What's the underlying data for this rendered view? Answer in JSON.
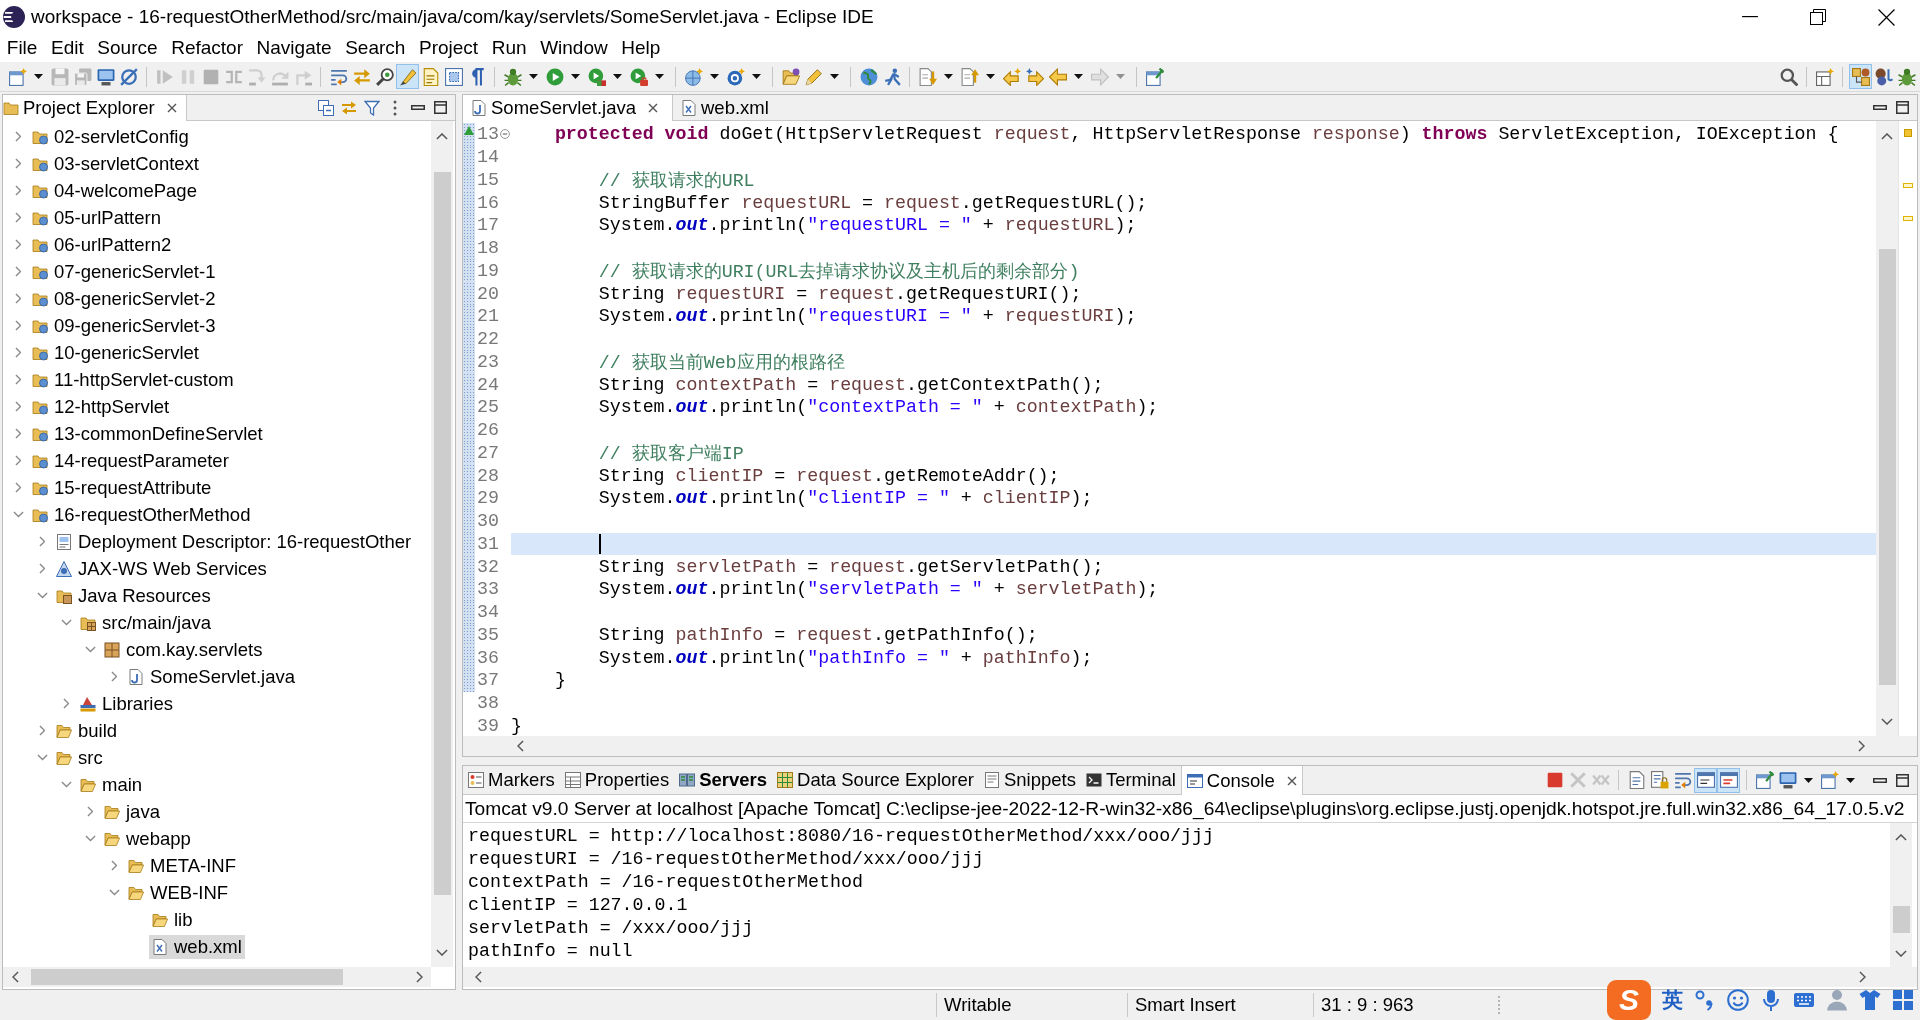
{
  "window": {
    "title": "workspace - 16-requestOtherMethod/src/main/java/com/kay/servlets/SomeServlet.java - Eclipse IDE"
  },
  "menu": [
    {
      "label": "File"
    },
    {
      "label": "Edit"
    },
    {
      "label": "Source"
    },
    {
      "label": "Refactor"
    },
    {
      "label": "Navigate"
    },
    {
      "label": "Search"
    },
    {
      "label": "Project"
    },
    {
      "label": "Run"
    },
    {
      "label": "Window"
    },
    {
      "label": "Help"
    }
  ],
  "toolbar": {
    "main": [
      [
        {
          "kind": "new_wizard",
          "disabled": false,
          "pressed": false,
          "dropdown": true
        },
        {
          "kind": "save",
          "disabled": true,
          "pressed": false,
          "dropdown": false
        },
        {
          "kind": "save_all",
          "disabled": true,
          "pressed": false,
          "dropdown": false
        },
        {
          "kind": "terminal",
          "disabled": false,
          "pressed": false,
          "dropdown": false
        },
        {
          "kind": "skip_breakpoints",
          "disabled": false,
          "pressed": false,
          "dropdown": false
        }
      ],
      [
        {
          "kind": "resume",
          "disabled": true,
          "pressed": false,
          "dropdown": false
        },
        {
          "kind": "suspend",
          "disabled": true,
          "pressed": false,
          "dropdown": false
        },
        {
          "kind": "terminate",
          "disabled": true,
          "pressed": false,
          "dropdown": false
        },
        {
          "kind": "disconnect",
          "disabled": true,
          "pressed": false,
          "dropdown": false
        },
        {
          "kind": "step_into",
          "disabled": true,
          "pressed": false,
          "dropdown": false
        },
        {
          "kind": "step_over",
          "disabled": true,
          "pressed": false,
          "dropdown": false
        },
        {
          "kind": "step_return",
          "disabled": true,
          "pressed": false,
          "dropdown": false
        }
      ],
      [
        {
          "kind": "word_wrap",
          "disabled": false,
          "pressed": false,
          "dropdown": false
        },
        {
          "kind": "swap",
          "disabled": false,
          "pressed": false,
          "dropdown": false
        },
        {
          "kind": "inspect",
          "disabled": false,
          "pressed": false,
          "dropdown": false
        },
        {
          "kind": "mark_occurrences",
          "disabled": false,
          "pressed": true,
          "dropdown": false
        },
        {
          "kind": "annotation",
          "disabled": false,
          "pressed": false,
          "dropdown": false
        },
        {
          "kind": "block_selection",
          "disabled": false,
          "pressed": false,
          "dropdown": false
        },
        {
          "kind": "whitespace",
          "disabled": false,
          "pressed": false,
          "dropdown": false
        }
      ],
      [
        {
          "kind": "debug",
          "disabled": false,
          "pressed": false,
          "dropdown": true
        },
        {
          "kind": "run",
          "disabled": false,
          "pressed": false,
          "dropdown": true
        },
        {
          "kind": "coverage",
          "disabled": false,
          "pressed": false,
          "dropdown": true
        },
        {
          "kind": "external_tools",
          "disabled": false,
          "pressed": false,
          "dropdown": true
        }
      ],
      [
        {
          "kind": "new_server",
          "disabled": false,
          "pressed": false,
          "dropdown": true
        },
        {
          "kind": "new_class",
          "disabled": false,
          "pressed": false,
          "dropdown": true
        }
      ],
      [
        {
          "kind": "open_type",
          "disabled": false,
          "pressed": false,
          "dropdown": false
        },
        {
          "kind": "search_pencil",
          "disabled": false,
          "pressed": false,
          "dropdown": true
        }
      ],
      [
        {
          "kind": "browser",
          "disabled": false,
          "pressed": false,
          "dropdown": false
        },
        {
          "kind": "runner",
          "disabled": false,
          "pressed": false,
          "dropdown": false
        }
      ],
      [
        {
          "kind": "next_annotation",
          "disabled": false,
          "pressed": false,
          "dropdown": true
        },
        {
          "kind": "prev_annotation",
          "disabled": false,
          "pressed": false,
          "dropdown": true
        },
        {
          "kind": "last_edit_back",
          "disabled": false,
          "pressed": false,
          "dropdown": false
        },
        {
          "kind": "last_edit_forward",
          "disabled": false,
          "pressed": false,
          "dropdown": false
        },
        {
          "kind": "back",
          "disabled": false,
          "pressed": false,
          "dropdown": true
        },
        {
          "kind": "forward",
          "disabled": true,
          "pressed": false,
          "dropdown": true
        }
      ],
      [
        {
          "kind": "pin_editor",
          "disabled": false,
          "pressed": false,
          "dropdown": false
        }
      ]
    ],
    "right": [
      [
        {
          "kind": "search",
          "disabled": false,
          "pressed": false,
          "dropdown": false
        }
      ],
      [
        {
          "kind": "open_perspective",
          "disabled": false,
          "pressed": false,
          "dropdown": false
        }
      ],
      [
        {
          "kind": "perspective_javaee",
          "disabled": false,
          "pressed": true,
          "dropdown": false
        },
        {
          "kind": "perspective_java",
          "disabled": false,
          "pressed": false,
          "dropdown": false
        },
        {
          "kind": "perspective_debug",
          "disabled": false,
          "pressed": false,
          "dropdown": false
        }
      ]
    ]
  },
  "project_explorer": {
    "title": "Project Explorer",
    "tree": [
      {
        "label": "02-servletConfig",
        "kind": "project",
        "expanded": false,
        "selected": false
      },
      {
        "label": "03-servletContext",
        "kind": "project",
        "expanded": false,
        "selected": false
      },
      {
        "label": "04-welcomePage",
        "kind": "project",
        "expanded": false,
        "selected": false
      },
      {
        "label": "05-urlPattern",
        "kind": "project",
        "expanded": false,
        "selected": false
      },
      {
        "label": "06-urlPattern2",
        "kind": "project",
        "expanded": false,
        "selected": false
      },
      {
        "label": "07-genericServlet-1",
        "kind": "project",
        "expanded": false,
        "selected": false
      },
      {
        "label": "08-genericServlet-2",
        "kind": "project",
        "expanded": false,
        "selected": false
      },
      {
        "label": "09-genericServlet-3",
        "kind": "project",
        "expanded": false,
        "selected": false
      },
      {
        "label": "10-genericServlet",
        "kind": "project",
        "expanded": false,
        "selected": false
      },
      {
        "label": "11-httpServlet-custom",
        "kind": "project",
        "expanded": false,
        "selected": false
      },
      {
        "label": "12-httpServlet",
        "kind": "project",
        "expanded": false,
        "selected": false
      },
      {
        "label": "13-commonDefineServlet",
        "kind": "project",
        "expanded": false,
        "selected": false
      },
      {
        "label": "14-requestParameter",
        "kind": "project",
        "expanded": false,
        "selected": false
      },
      {
        "label": "15-requestAttribute",
        "kind": "project",
        "expanded": false,
        "selected": false
      },
      {
        "label": "16-requestOtherMethod",
        "kind": "project",
        "expanded": true,
        "selected": false,
        "children": [
          {
            "label": "Deployment Descriptor: 16-requestOther",
            "kind": "descriptor",
            "expanded": false,
            "selected": false
          },
          {
            "label": "JAX-WS Web Services",
            "kind": "web_services",
            "expanded": false,
            "selected": false
          },
          {
            "label": "Java Resources",
            "kind": "java_resources",
            "expanded": true,
            "selected": false,
            "children": [
              {
                "label": "src/main/java",
                "kind": "source_folder",
                "expanded": true,
                "selected": false,
                "children": [
                  {
                    "label": "com.kay.servlets",
                    "kind": "package",
                    "expanded": true,
                    "selected": false,
                    "children": [
                      {
                        "label": "SomeServlet.java",
                        "kind": "java_file",
                        "expanded": false,
                        "selected": false
                      }
                    ]
                  }
                ]
              },
              {
                "label": "Libraries",
                "kind": "libraries",
                "expanded": false,
                "selected": false
              }
            ]
          },
          {
            "label": "build",
            "kind": "folder",
            "expanded": false,
            "selected": false
          },
          {
            "label": "src",
            "kind": "folder",
            "expanded": true,
            "selected": false,
            "children": [
              {
                "label": "main",
                "kind": "folder",
                "expanded": true,
                "selected": false,
                "children": [
                  {
                    "label": "java",
                    "kind": "folder",
                    "expanded": false,
                    "selected": false
                  },
                  {
                    "label": "webapp",
                    "kind": "folder",
                    "expanded": true,
                    "selected": false,
                    "children": [
                      {
                        "label": "META-INF",
                        "kind": "folder",
                        "expanded": false,
                        "selected": false
                      },
                      {
                        "label": "WEB-INF",
                        "kind": "folder",
                        "expanded": true,
                        "selected": false,
                        "children": [
                          {
                            "label": "lib",
                            "kind": "folder",
                            "selected": false
                          },
                          {
                            "label": "web.xml",
                            "kind": "xml_file",
                            "selected": true
                          }
                        ]
                      }
                    ]
                  }
                ]
              }
            ]
          }
        ]
      }
    ]
  },
  "editor": {
    "tabs": [
      {
        "label": "SomeServlet.java",
        "kind": "java",
        "selected": true
      },
      {
        "label": "web.xml",
        "kind": "xml",
        "selected": false
      }
    ],
    "lines": [
      {
        "number": "13",
        "range": true,
        "override": true,
        "fold": true,
        "current": false,
        "tokens": [
          {
            "kind": "keyword",
            "text": "    protected void"
          },
          {
            "kind": "plain",
            "text": " doGet(HttpServletRequest "
          },
          {
            "kind": "variable",
            "text": "request"
          },
          {
            "kind": "plain",
            "text": ", HttpServletResponse "
          },
          {
            "kind": "variable",
            "text": "response"
          },
          {
            "kind": "plain",
            "text": ") "
          },
          {
            "kind": "keyword",
            "text": "throws"
          },
          {
            "kind": "plain",
            "text": " ServletException, IOException {"
          }
        ]
      },
      {
        "number": "14",
        "range": true,
        "override": false,
        "fold": false,
        "current": false
      },
      {
        "number": "15",
        "range": true,
        "override": false,
        "fold": false,
        "current": false,
        "tokens": [
          {
            "kind": "comment",
            "text": "        // 获取请求的URL"
          }
        ]
      },
      {
        "number": "16",
        "range": true,
        "override": false,
        "fold": false,
        "current": false,
        "tokens": [
          {
            "kind": "plain",
            "text": "        StringBuffer "
          },
          {
            "kind": "variable",
            "text": "requestURL"
          },
          {
            "kind": "plain",
            "text": " = "
          },
          {
            "kind": "variable",
            "text": "request"
          },
          {
            "kind": "plain",
            "text": ".getRequestURL();"
          }
        ]
      },
      {
        "number": "17",
        "range": true,
        "override": false,
        "fold": false,
        "current": false,
        "tokens": [
          {
            "kind": "plain",
            "text": "        System."
          },
          {
            "kind": "field",
            "text": "out"
          },
          {
            "kind": "plain",
            "text": ".println("
          },
          {
            "kind": "string",
            "text": "\"requestURL = \""
          },
          {
            "kind": "plain",
            "text": " + "
          },
          {
            "kind": "variable",
            "text": "requestURL"
          },
          {
            "kind": "plain",
            "text": ");"
          }
        ]
      },
      {
        "number": "18",
        "range": true,
        "override": false,
        "fold": false,
        "current": false
      },
      {
        "number": "19",
        "range": true,
        "override": false,
        "fold": false,
        "current": false,
        "tokens": [
          {
            "kind": "comment",
            "text": "        // 获取请求的URI(URL去掉请求协议及主机后的剩余部分)"
          }
        ]
      },
      {
        "number": "20",
        "range": true,
        "override": false,
        "fold": false,
        "current": false,
        "tokens": [
          {
            "kind": "plain",
            "text": "        String "
          },
          {
            "kind": "variable",
            "text": "requestURI"
          },
          {
            "kind": "plain",
            "text": " = "
          },
          {
            "kind": "variable",
            "text": "request"
          },
          {
            "kind": "plain",
            "text": ".getRequestURI();"
          }
        ]
      },
      {
        "number": "21",
        "range": true,
        "override": false,
        "fold": false,
        "current": false,
        "tokens": [
          {
            "kind": "plain",
            "text": "        System."
          },
          {
            "kind": "field",
            "text": "out"
          },
          {
            "kind": "plain",
            "text": ".println("
          },
          {
            "kind": "string",
            "text": "\"requestURI = \""
          },
          {
            "kind": "plain",
            "text": " + "
          },
          {
            "kind": "variable",
            "text": "requestURI"
          },
          {
            "kind": "plain",
            "text": ");"
          }
        ]
      },
      {
        "number": "22",
        "range": true,
        "override": false,
        "fold": false,
        "current": false
      },
      {
        "number": "23",
        "range": true,
        "override": false,
        "fold": false,
        "current": false,
        "tokens": [
          {
            "kind": "comment",
            "text": "        // 获取当前Web应用的根路径"
          }
        ]
      },
      {
        "number": "24",
        "range": true,
        "override": false,
        "fold": false,
        "current": false,
        "tokens": [
          {
            "kind": "plain",
            "text": "        String "
          },
          {
            "kind": "variable",
            "text": "contextPath"
          },
          {
            "kind": "plain",
            "text": " = "
          },
          {
            "kind": "variable",
            "text": "request"
          },
          {
            "kind": "plain",
            "text": ".getContextPath();"
          }
        ]
      },
      {
        "number": "25",
        "range": true,
        "override": false,
        "fold": false,
        "current": false,
        "tokens": [
          {
            "kind": "plain",
            "text": "        System."
          },
          {
            "kind": "field",
            "text": "out"
          },
          {
            "kind": "plain",
            "text": ".println("
          },
          {
            "kind": "string",
            "text": "\"contextPath = \""
          },
          {
            "kind": "plain",
            "text": " + "
          },
          {
            "kind": "variable",
            "text": "contextPath"
          },
          {
            "kind": "plain",
            "text": ");"
          }
        ]
      },
      {
        "number": "26",
        "range": true,
        "override": false,
        "fold": false,
        "current": false
      },
      {
        "number": "27",
        "range": true,
        "override": false,
        "fold": false,
        "current": false,
        "tokens": [
          {
            "kind": "comment",
            "text": "        // 获取客户端IP"
          }
        ]
      },
      {
        "number": "28",
        "range": true,
        "override": false,
        "fold": false,
        "current": false,
        "tokens": [
          {
            "kind": "plain",
            "text": "        String "
          },
          {
            "kind": "variable",
            "text": "clientIP"
          },
          {
            "kind": "plain",
            "text": " = "
          },
          {
            "kind": "variable",
            "text": "request"
          },
          {
            "kind": "plain",
            "text": ".getRemoteAddr();"
          }
        ]
      },
      {
        "number": "29",
        "range": true,
        "override": false,
        "fold": false,
        "current": false,
        "tokens": [
          {
            "kind": "plain",
            "text": "        System."
          },
          {
            "kind": "field",
            "text": "out"
          },
          {
            "kind": "plain",
            "text": ".println("
          },
          {
            "kind": "string",
            "text": "\"clientIP = \""
          },
          {
            "kind": "plain",
            "text": " + "
          },
          {
            "kind": "variable",
            "text": "clientIP"
          },
          {
            "kind": "plain",
            "text": ");"
          }
        ]
      },
      {
        "number": "30",
        "range": true,
        "override": false,
        "fold": false,
        "current": false
      },
      {
        "number": "31",
        "range": true,
        "override": false,
        "fold": false,
        "current": true
      },
      {
        "number": "32",
        "range": true,
        "override": false,
        "fold": false,
        "current": false,
        "tokens": [
          {
            "kind": "plain",
            "text": "        String "
          },
          {
            "kind": "variable",
            "text": "servletPath"
          },
          {
            "kind": "plain",
            "text": " = "
          },
          {
            "kind": "variable",
            "text": "request"
          },
          {
            "kind": "plain",
            "text": ".getServletPath();"
          }
        ]
      },
      {
        "number": "33",
        "range": true,
        "override": false,
        "fold": false,
        "current": false,
        "tokens": [
          {
            "kind": "plain",
            "text": "        System."
          },
          {
            "kind": "field",
            "text": "out"
          },
          {
            "kind": "plain",
            "text": ".println("
          },
          {
            "kind": "string",
            "text": "\"servletPath = \""
          },
          {
            "kind": "plain",
            "text": " + "
          },
          {
            "kind": "variable",
            "text": "servletPath"
          },
          {
            "kind": "plain",
            "text": ");"
          }
        ]
      },
      {
        "number": "34",
        "range": true,
        "override": false,
        "fold": false,
        "current": false
      },
      {
        "number": "35",
        "range": true,
        "override": false,
        "fold": false,
        "current": false,
        "tokens": [
          {
            "kind": "plain",
            "text": "        String "
          },
          {
            "kind": "variable",
            "text": "pathInfo"
          },
          {
            "kind": "plain",
            "text": " = "
          },
          {
            "kind": "variable",
            "text": "request"
          },
          {
            "kind": "plain",
            "text": ".getPathInfo();"
          }
        ]
      },
      {
        "number": "36",
        "range": true,
        "override": false,
        "fold": false,
        "current": false,
        "tokens": [
          {
            "kind": "plain",
            "text": "        System."
          },
          {
            "kind": "field",
            "text": "out"
          },
          {
            "kind": "plain",
            "text": ".println("
          },
          {
            "kind": "string",
            "text": "\"pathInfo = \""
          },
          {
            "kind": "plain",
            "text": " + "
          },
          {
            "kind": "variable",
            "text": "pathInfo"
          },
          {
            "kind": "plain",
            "text": ");"
          }
        ]
      },
      {
        "number": "37",
        "range": true,
        "override": false,
        "fold": false,
        "current": false,
        "tokens": [
          {
            "kind": "plain",
            "text": "    }"
          }
        ]
      },
      {
        "number": "38",
        "range": false,
        "override": false,
        "fold": false,
        "current": false
      },
      {
        "number": "39",
        "range": false,
        "override": false,
        "fold": false,
        "current": false,
        "tokens": [
          {
            "kind": "plain",
            "text": "}"
          }
        ]
      }
    ]
  },
  "console_view": {
    "tabs": [
      {
        "label": "Markers",
        "kind": "markers",
        "selected": false,
        "updated": false
      },
      {
        "label": "Properties",
        "kind": "properties",
        "selected": false,
        "updated": false
      },
      {
        "label": "Servers",
        "kind": "servers",
        "selected": false,
        "updated": true
      },
      {
        "label": "Data Source Explorer",
        "kind": "data_source",
        "selected": false,
        "updated": false
      },
      {
        "label": "Snippets",
        "kind": "snippets",
        "selected": false,
        "updated": false
      },
      {
        "label": "Terminal",
        "kind": "terminal",
        "selected": false,
        "updated": false
      },
      {
        "label": "Console",
        "kind": "console",
        "selected": true,
        "updated": false
      }
    ],
    "toolbar": [
      [
        {
          "kind": "terminate",
          "disabled": false,
          "pressed": false,
          "dropdown": false
        },
        {
          "kind": "remove_launch",
          "disabled": true,
          "pressed": false,
          "dropdown": false
        },
        {
          "kind": "remove_all",
          "disabled": true,
          "pressed": false,
          "dropdown": false
        }
      ],
      [
        {
          "kind": "clear_console",
          "disabled": false,
          "pressed": false,
          "dropdown": false
        },
        {
          "kind": "scroll_lock",
          "disabled": false,
          "pressed": false,
          "dropdown": false
        },
        {
          "kind": "word_wrap",
          "disabled": false,
          "pressed": false,
          "dropdown": false
        },
        {
          "kind": "show_stdout",
          "disabled": false,
          "pressed": true,
          "dropdown": false
        },
        {
          "kind": "show_stderr",
          "disabled": false,
          "pressed": true,
          "dropdown": false
        }
      ],
      [
        {
          "kind": "pin_console",
          "disabled": false,
          "pressed": false,
          "dropdown": false
        },
        {
          "kind": "display_console",
          "disabled": false,
          "pressed": false,
          "dropdown": true
        },
        {
          "kind": "open_console",
          "disabled": false,
          "pressed": false,
          "dropdown": true
        }
      ]
    ],
    "title": "Tomcat v9.0 Server at localhost [Apache Tomcat] C:\\eclipse-jee-2022-12-R-win32-x86_64\\eclipse\\plugins\\org.eclipse.justj.openjdk.hotspot.jre.full.win32.x86_64_17.0.5.v2",
    "lines": [
      "requestURL = http://localhost:8080/16-requestOtherMethod/xxx/ooo/jjj",
      "requestURI = /16-requestOtherMethod/xxx/ooo/jjj",
      "contextPath = /16-requestOtherMethod",
      "clientIP = 127.0.0.1",
      "servletPath = /xxx/ooo/jjj",
      "pathInfo = null"
    ]
  },
  "status_bar": {
    "fields": [
      "Writable",
      "Smart Insert",
      "31 : 9 : 963"
    ]
  },
  "ime_toolbar": {
    "logo": "S",
    "language": "英"
  }
}
